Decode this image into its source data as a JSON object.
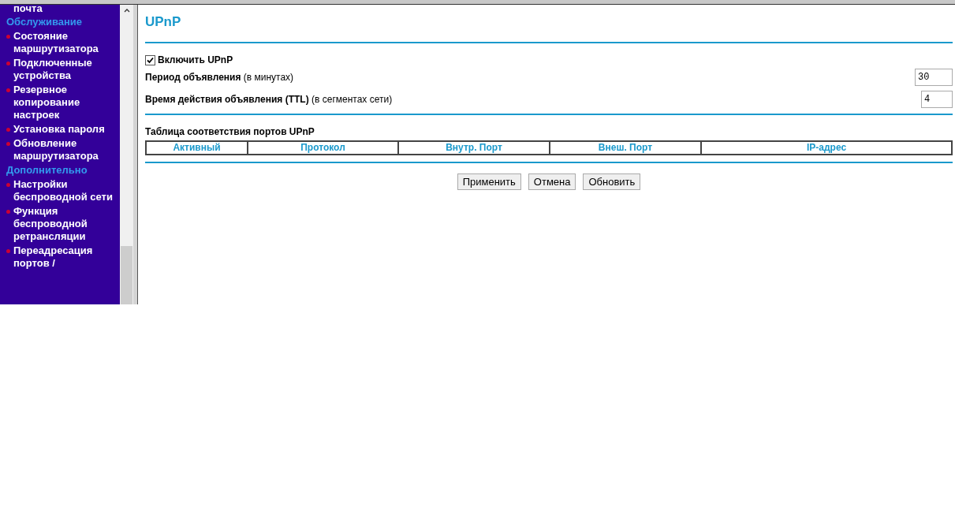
{
  "sidebar": {
    "items": [
      {
        "kind": "fragment",
        "label": "почта"
      },
      {
        "kind": "heading",
        "label": "Обслуживание"
      },
      {
        "kind": "item",
        "label": "Состояние маршрутизатора"
      },
      {
        "kind": "item",
        "label": "Подключенные устройства"
      },
      {
        "kind": "item",
        "label": "Резервное копирование настроек"
      },
      {
        "kind": "item",
        "label": "Установка пароля"
      },
      {
        "kind": "item",
        "label": "Обновление маршрутизатора"
      },
      {
        "kind": "heading",
        "label": "Дополнительно"
      },
      {
        "kind": "item",
        "label": "Настройки беспроводной сети"
      },
      {
        "kind": "item",
        "label": "Функция беспроводной ретрансляции"
      },
      {
        "kind": "item",
        "label": "Переадресация портов /"
      }
    ]
  },
  "page": {
    "title": "UPnP",
    "enable": {
      "label": "Включить UPnP",
      "checked": true
    },
    "fields": [
      {
        "label": "Период объявления",
        "note": "(в минутах)",
        "value": "30"
      },
      {
        "label": "Время действия объявления (TTL)",
        "note": "(в сегментах сети)",
        "value": "4"
      }
    ],
    "table": {
      "title": "Таблица соответствия портов UPnP",
      "columns": [
        "Активный",
        "Протокол",
        "Внутр. Порт",
        "Внеш. Порт",
        "IP-адрес"
      ]
    },
    "buttons": [
      "Применить",
      "Отмена",
      "Обновить"
    ]
  }
}
